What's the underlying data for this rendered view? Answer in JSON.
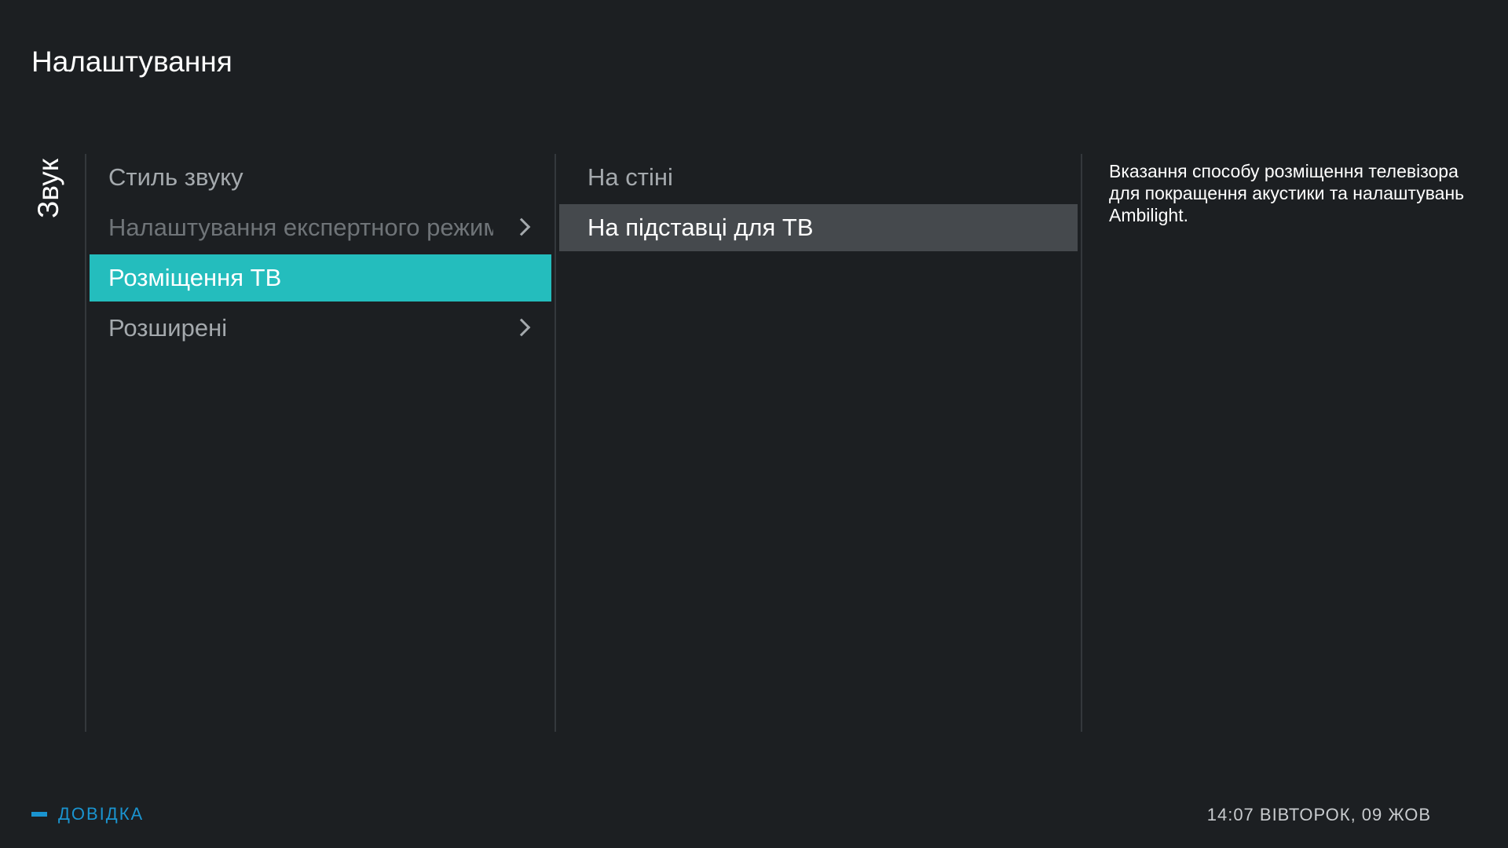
{
  "header": {
    "title": "Налаштування"
  },
  "section": {
    "label": "Звук"
  },
  "menu": {
    "items": [
      {
        "label": "Стиль звуку",
        "has_submenu": false,
        "state": "normal"
      },
      {
        "label": "Налаштування експертного режиму",
        "has_submenu": true,
        "state": "disabled"
      },
      {
        "label": "Розміщення ТВ",
        "has_submenu": false,
        "state": "selected"
      },
      {
        "label": "Розширені",
        "has_submenu": true,
        "state": "normal"
      }
    ]
  },
  "options": {
    "items": [
      {
        "label": "На стіні",
        "state": "normal"
      },
      {
        "label": "На підставці для ТВ",
        "state": "focused"
      }
    ]
  },
  "description": {
    "text": "Вказання способу розміщення телевізора для покращення акустики та налаштувань Ambilight."
  },
  "footer": {
    "help_label": "ДОВІДКА",
    "help_key_color": "#1a94d0",
    "clock": "14:07 ВІВТОРОК, 09 ЖОВ"
  },
  "colors": {
    "background": "#1c1f22",
    "accent": "#24bdbd",
    "focused_option": "#45494d"
  }
}
